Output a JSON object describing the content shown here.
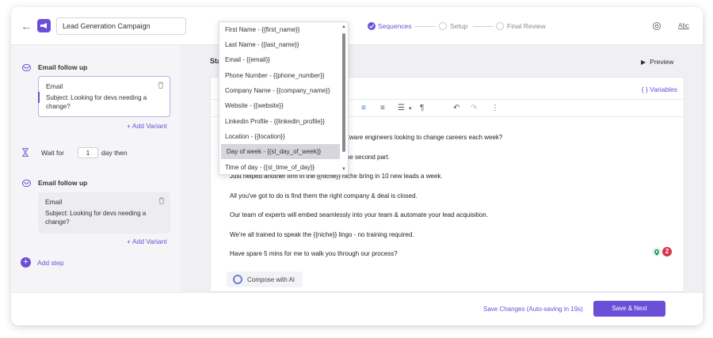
{
  "header": {
    "campaign_name": "Lead Generation Campaign",
    "steps": [
      {
        "label": "Sequences",
        "state": "done"
      },
      {
        "label": "Setup",
        "state": "pending"
      },
      {
        "label": "Final Review",
        "state": "pending"
      }
    ],
    "abc_label": "Abc"
  },
  "sidebar": {
    "steps": [
      {
        "title": "Email follow up",
        "type": "Email",
        "subject": "Subject: Looking for devs needing a change?",
        "add_variant": "+ Add Variant"
      },
      {
        "title": "Email follow up",
        "type": "Email",
        "subject": "Subject: Looking for devs needing a change?",
        "add_variant": "+ Add Variant"
      }
    ],
    "wait": {
      "prefix": "Wait for",
      "value": "1",
      "suffix": "day then"
    },
    "add_step": "Add step"
  },
  "editor": {
    "stage_label": "Sta",
    "preview_label": "Preview",
    "subject_tail": "e?",
    "variables_label": "{ } Variables",
    "lines": [
      "software engineers looking to change careers each week?",
      "e the second part.",
      "Just helped another firm in the {{niche}} niche bring in 10 new leads a week.",
      "All you've got to do is find them the right company & deal is closed.",
      "Our team of experts will embed seamlessly into your team & automate your lead acquisition.",
      "We're all trained to speak the {{niche}} lingo - no training required.",
      "Have spare 5 mins for me to walk you through our process?"
    ],
    "badge_count": "2",
    "compose_label": "Compose with AI"
  },
  "footer": {
    "save_changes": "Save Changes (Auto-saving in 19s)",
    "save_next": "Save & Next"
  },
  "dropdown": {
    "items": [
      "First Name - {{first_name}}",
      "Last Name - {{last_name}}",
      "Email - {{email}}",
      "Phone Number - {{phone_number}}",
      "Company Name - {{company_name}}",
      "Website - {{website}}",
      "Linkedin Profile - {{linkedin_profile}}",
      "Location - {{location}}",
      "Day of week - {{sl_day_of_week}}",
      "Time of day - {{sl_time_of_day}}"
    ],
    "selected_index": 8
  },
  "colors": {
    "accent": "#6b4fd8",
    "badge_red": "#d9364a",
    "badge_green": "#2e9c5b"
  }
}
